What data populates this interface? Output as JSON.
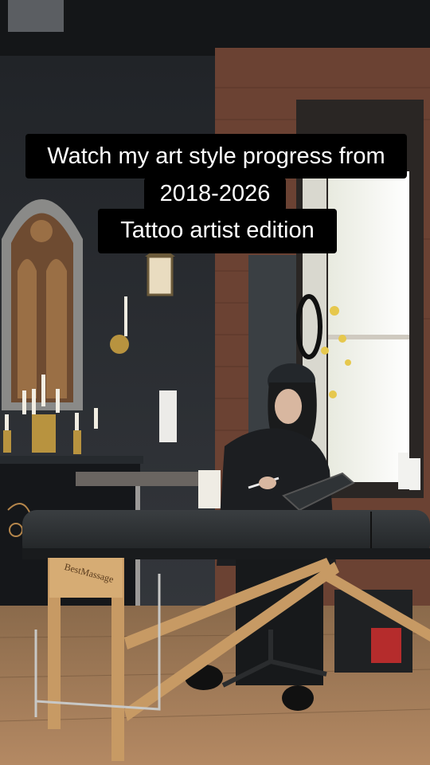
{
  "caption": {
    "line1": "Watch my art style progress from",
    "line2": "2018-2026",
    "line3": "Tattoo artist edition"
  },
  "massage_table": {
    "brand_label": "BestMassage"
  },
  "colors": {
    "wall": "#2c2f36",
    "brick": "#7a4a3a",
    "floor": "#a07b57",
    "table_top": "#2b2f31",
    "table_legs": "#c89a64",
    "caption_bg": "#000000",
    "caption_text": "#ffffff"
  }
}
